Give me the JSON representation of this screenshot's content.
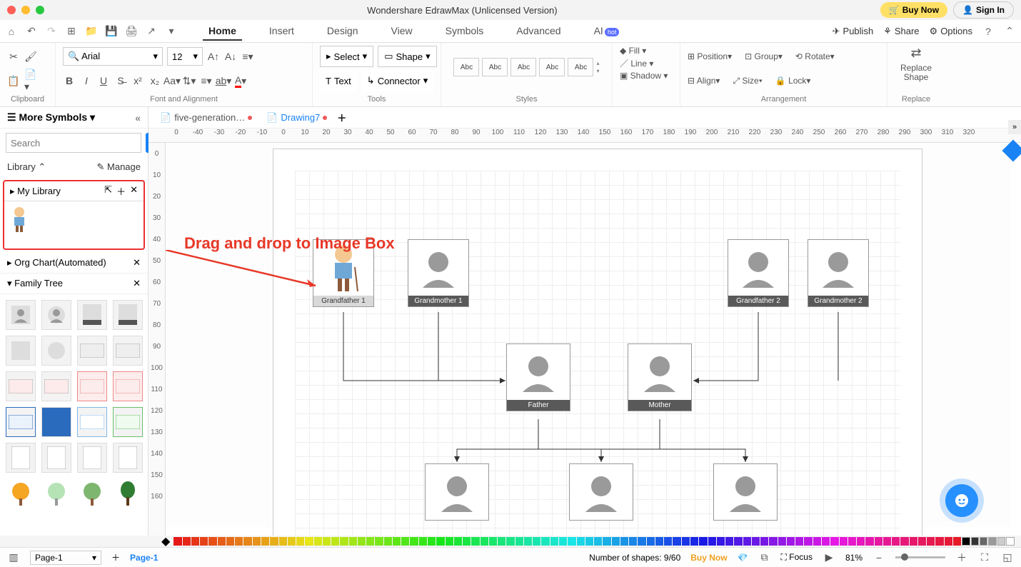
{
  "title": "Wondershare EdrawMax (Unlicensed Version)",
  "titlebar": {
    "buy_now": "Buy Now",
    "sign_in": "Sign In"
  },
  "menu": {
    "tabs": [
      "Home",
      "Insert",
      "Design",
      "View",
      "Symbols",
      "Advanced",
      "AI"
    ],
    "hot": "hot",
    "right": {
      "publish": "Publish",
      "share": "Share",
      "options": "Options"
    }
  },
  "ribbon": {
    "font_name": "Arial",
    "font_size": "12",
    "groups": {
      "clipboard": "Clipboard",
      "font": "Font and Alignment",
      "tools": "Tools",
      "styles": "Styles",
      "arrangement": "Arrangement",
      "replace": "Replace"
    },
    "select": "Select",
    "shape": "Shape",
    "text": "Text",
    "connector": "Connector",
    "style_abc": [
      "Abc",
      "Abc",
      "Abc",
      "Abc",
      "Abc"
    ],
    "fill": "Fill",
    "line": "Line",
    "shadow": "Shadow",
    "position": "Position",
    "group": "Group",
    "rotate": "Rotate",
    "align": "Align",
    "size": "Size",
    "lock": "Lock",
    "replace_shape": "Replace\nShape"
  },
  "left": {
    "more_symbols": "More Symbols",
    "search_ph": "Search",
    "search_btn": "Search",
    "library": "Library",
    "manage": "Manage",
    "my_library": "My Library",
    "org_chart": "Org Chart(Automated)",
    "family_tree": "Family Tree"
  },
  "doc_tabs": {
    "t1": "five-generation…",
    "t2": "Drawing7"
  },
  "ruler_h": [
    "0",
    "-40",
    "-30",
    "-20",
    "-10",
    "0",
    "10",
    "20",
    "30",
    "40",
    "50",
    "60",
    "70",
    "80",
    "90",
    "100",
    "110",
    "120",
    "130",
    "140",
    "150",
    "160",
    "170",
    "180",
    "190",
    "200",
    "210",
    "220",
    "230",
    "240",
    "250",
    "260",
    "270",
    "280",
    "290",
    "300",
    "310",
    "320"
  ],
  "ruler_v": [
    "0",
    "10",
    "20",
    "30",
    "40",
    "50",
    "60",
    "70",
    "80",
    "90",
    "100",
    "110",
    "120",
    "130",
    "140",
    "150",
    "160"
  ],
  "annotation": "Drag and drop to Image Box",
  "cards": {
    "gf1": "Grandfather 1",
    "gm1": "Grandmother 1",
    "gf2": "Grandfather 2",
    "gm2": "Grandmother 2",
    "father": "Father",
    "mother": "Mother"
  },
  "status": {
    "page_sel": "Page-1",
    "page_tab": "Page-1",
    "shapes": "Number of shapes: 9/60",
    "buy_now": "Buy Now",
    "focus": "Focus",
    "zoom": "81%"
  }
}
